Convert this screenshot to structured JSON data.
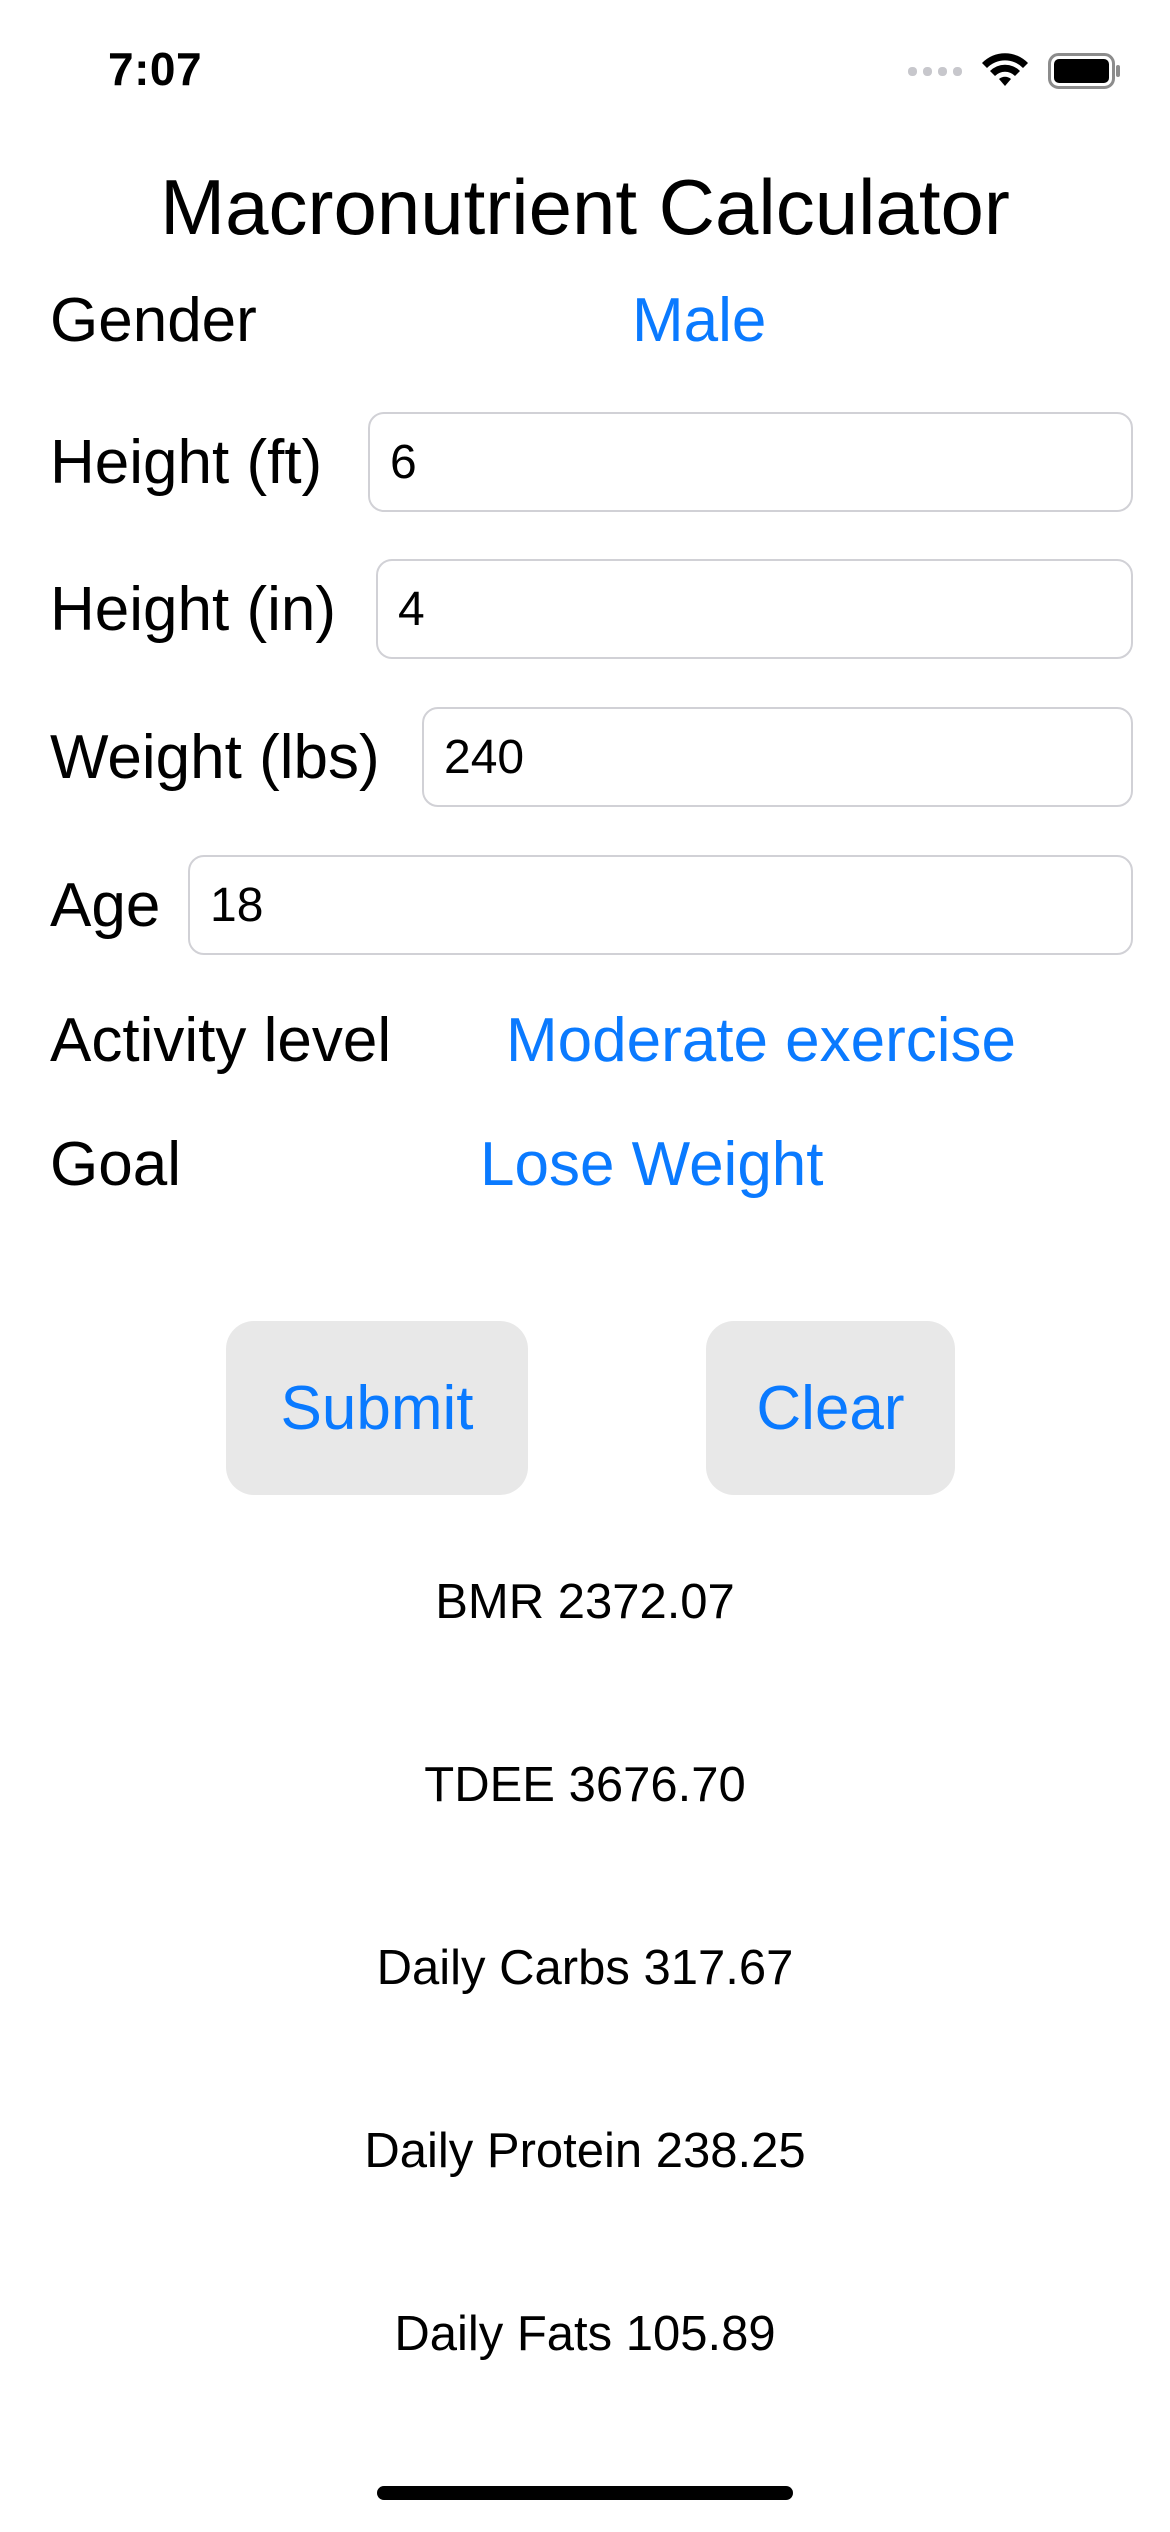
{
  "status_bar": {
    "time": "7:07"
  },
  "title": "Macronutrient Calculator",
  "form": {
    "gender": {
      "label": "Gender",
      "value": "Male"
    },
    "height_ft": {
      "label": "Height (ft)",
      "value": "6"
    },
    "height_in": {
      "label": "Height (in)",
      "value": "4"
    },
    "weight": {
      "label": "Weight (lbs)",
      "value": "240"
    },
    "age": {
      "label": "Age",
      "value": "18"
    },
    "activity": {
      "label": "Activity level",
      "value": "Moderate exercise"
    },
    "goal": {
      "label": "Goal",
      "value": "Lose Weight"
    }
  },
  "buttons": {
    "submit": "Submit",
    "clear": "Clear"
  },
  "results": {
    "bmr": "BMR 2372.07",
    "tdee": "TDEE 3676.70",
    "carbs": "Daily Carbs 317.67",
    "protein": "Daily Protein 238.25",
    "fats": "Daily Fats 105.89"
  },
  "colors": {
    "accent": "#0a7aff",
    "button_bg": "#e8e8e8",
    "field_border": "#d1d1d6"
  }
}
